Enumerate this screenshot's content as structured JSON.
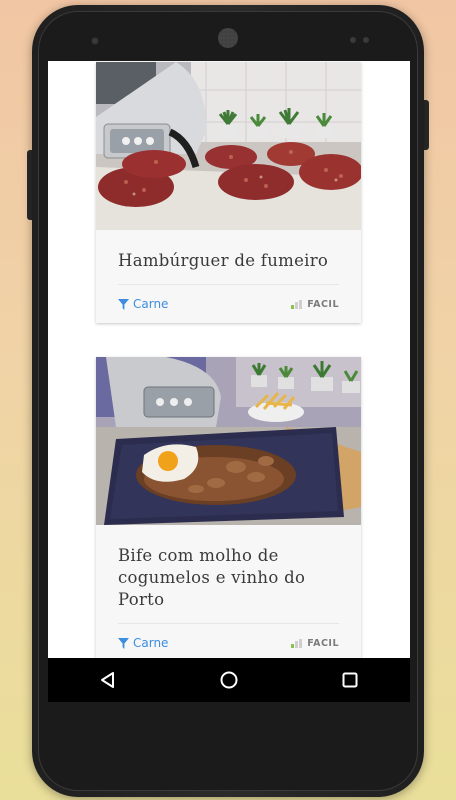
{
  "cards": [
    {
      "title": "Hambúrguer de fumeiro",
      "category": "Carne",
      "difficulty": "FACIL",
      "difficulty_level": 0.33,
      "photo": "burgers-thermomix"
    },
    {
      "title": "Bife com molho de cogumelos e vinho do Porto",
      "category": "Carne",
      "difficulty": "FACIL",
      "difficulty_level": 0.33,
      "photo": "steak-mushroom-sauce"
    }
  ],
  "navbar": {
    "back": "back-icon",
    "home": "home-icon",
    "recents": "recents-icon"
  },
  "colors": {
    "accent": "#3d8de0",
    "difficulty_on": "#8bc34a",
    "difficulty_off": "#cfcfcf"
  }
}
